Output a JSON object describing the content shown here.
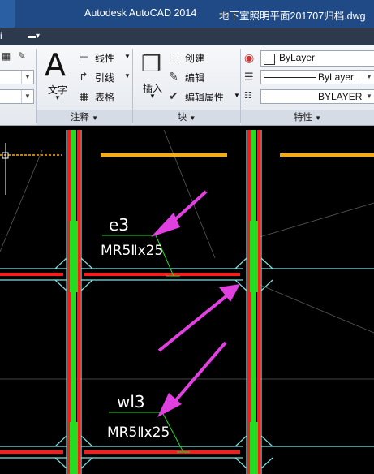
{
  "titlebar": {
    "app_name": "Autodesk AutoCAD 2014",
    "document_name": "地下室照明平面201707归档.dwg"
  },
  "menubar": {
    "item_fragment": "i"
  },
  "ribbon": {
    "annotation_group": {
      "title": "注释",
      "text_tool": "文字",
      "linear_tool": "线性",
      "leader_tool": "引线",
      "table_tool": "表格"
    },
    "block_group": {
      "title": "块",
      "insert_tool": "插入",
      "create_tool": "创建",
      "edit_tool": "编辑",
      "edit_attributes_tool": "编辑属性"
    },
    "properties_group": {
      "title": "特性",
      "layer_color": "ByLayer",
      "linetype": "ByLayer",
      "lineweight": "BYLAYER"
    }
  },
  "drawing": {
    "label_e3": "e3",
    "label_e3_spec": "MR5Ⅱx25",
    "label_wl3": "wl3",
    "label_wl3_spec": "MR5Ⅱx25",
    "colors": {
      "background": "#000000",
      "beam_red": "#ff1a1a",
      "column_green": "#22dd22",
      "outline_cyan": "#7fe0e0",
      "dash_orange": "#ffaa00",
      "arrow_magenta": "#e040e0"
    }
  }
}
